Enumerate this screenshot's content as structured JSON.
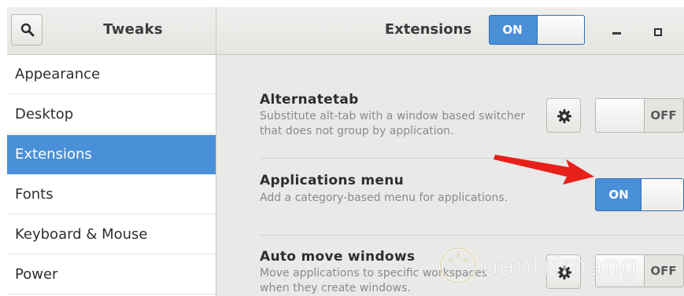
{
  "window": {
    "app_title": "Tweaks",
    "page_title": "Extensions",
    "master_switch": {
      "state": "ON"
    }
  },
  "sidebar": {
    "items": [
      {
        "label": "Appearance",
        "selected": false
      },
      {
        "label": "Desktop",
        "selected": false
      },
      {
        "label": "Extensions",
        "selected": true
      },
      {
        "label": "Fonts",
        "selected": false
      },
      {
        "label": "Keyboard & Mouse",
        "selected": false
      },
      {
        "label": "Power",
        "selected": false
      }
    ]
  },
  "extensions": [
    {
      "name": "Alternatetab",
      "description": "Substitute alt-tab with a window based switcher that does not group by application.",
      "has_settings": true,
      "switch_label": "OFF"
    },
    {
      "name": "Applications menu",
      "description": "Add a category-based menu for applications.",
      "has_settings": false,
      "switch_label": "ON"
    },
    {
      "name": "Auto move windows",
      "description": "Move applications to specific workspaces when they create windows.",
      "has_settings": true,
      "switch_label": "OFF"
    }
  ],
  "watermark": {
    "text": "uantrimang"
  },
  "colors": {
    "accent": "#4a90d9",
    "annotation_arrow": "#e8201a"
  },
  "icons": [
    "search-icon",
    "gear-icon",
    "minimize-icon",
    "maximize-icon"
  ]
}
